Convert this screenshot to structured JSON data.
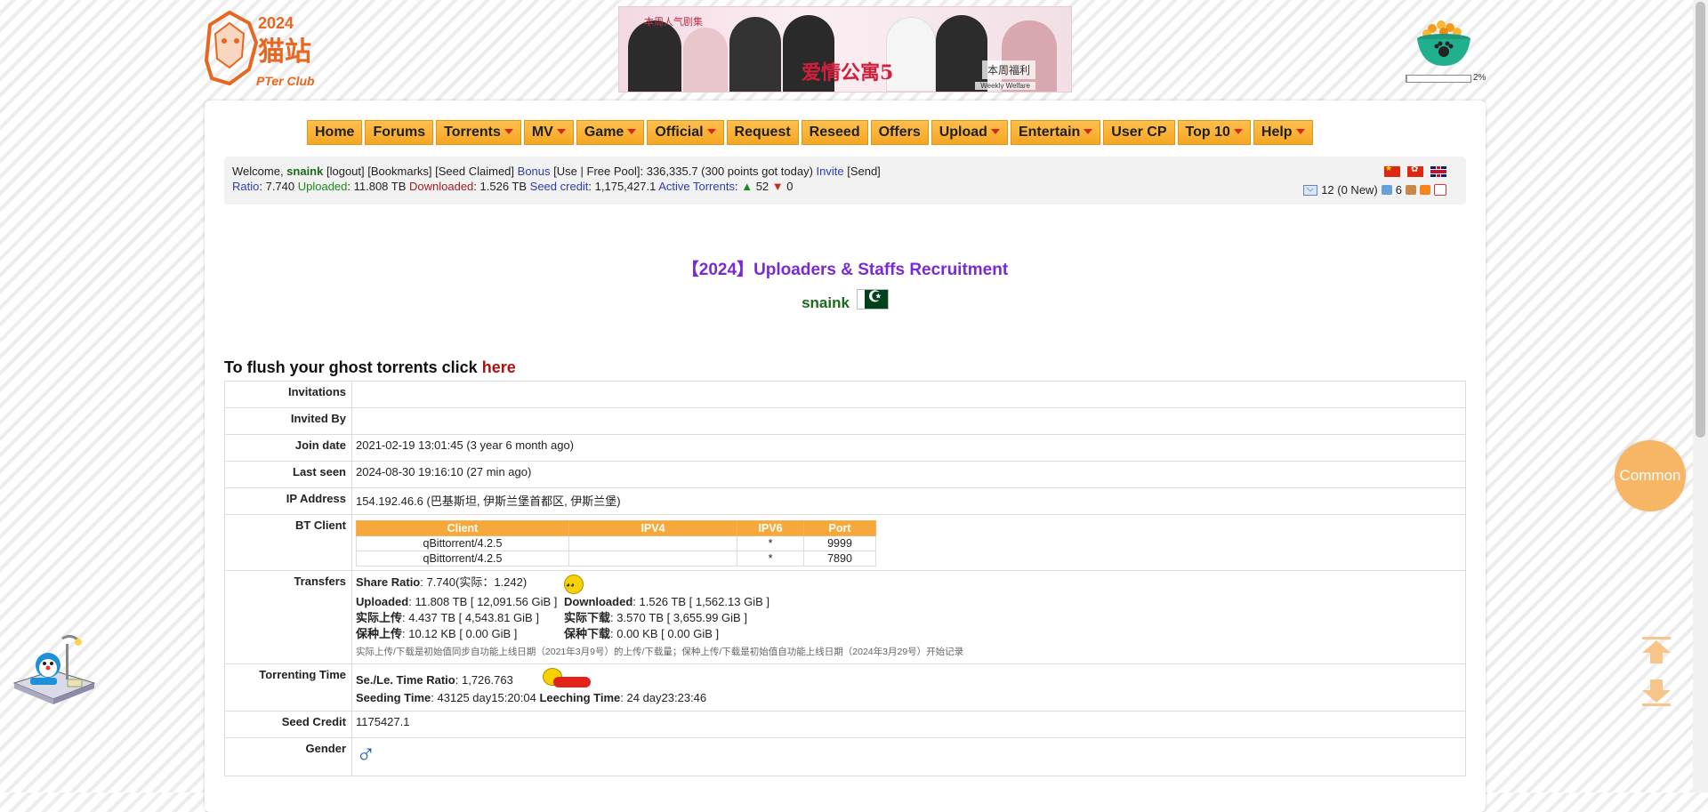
{
  "logo": {
    "text_main": "猫站",
    "text_sub": "PTer Club",
    "year": "2024"
  },
  "banner": {
    "title": "爱情公寓5",
    "top_text": "本周人气剧集",
    "side_text": "本周福利",
    "side_sub": "Weekly Welfare"
  },
  "progress": {
    "percent": 2,
    "label": "2%"
  },
  "nav": [
    {
      "label": "Home",
      "dropdown": false
    },
    {
      "label": "Forums",
      "dropdown": false
    },
    {
      "label": "Torrents",
      "dropdown": true
    },
    {
      "label": "MV",
      "dropdown": true
    },
    {
      "label": "Game",
      "dropdown": true
    },
    {
      "label": "Official",
      "dropdown": true
    },
    {
      "label": "Request",
      "dropdown": false
    },
    {
      "label": "Reseed",
      "dropdown": false
    },
    {
      "label": "Offers",
      "dropdown": false
    },
    {
      "label": "Upload",
      "dropdown": true
    },
    {
      "label": "Entertain",
      "dropdown": true
    },
    {
      "label": "User CP",
      "dropdown": false
    },
    {
      "label": "Top 10",
      "dropdown": true
    },
    {
      "label": "Help",
      "dropdown": true
    }
  ],
  "userbar": {
    "welcome": "Welcome, ",
    "username": "snaink",
    "logout": "[logout]",
    "bookmarks": "[Bookmarks]",
    "seed_claimed": "[Seed Claimed]",
    "bonus_label": "Bonus",
    "bonus_use_open": " [",
    "bonus_use": "Use",
    "bonus_sep": " | ",
    "free_pool": "Free Pool",
    "bonus_value": "]: 336,335.7 (300 points got today) ",
    "invite": "Invite",
    "send": " [Send]",
    "ratio_label": "Ratio",
    "ratio_value": ": 7.740 ",
    "uploaded_label": "Uploaded",
    "uploaded_value": ": 11.808 TB ",
    "downloaded_label": "Downloaded",
    "downloaded_value": ": 1.526 TB ",
    "seed_credit_label": "Seed credit",
    "seed_credit_value": ": 1,175,427.1 ",
    "active_label": "Active Torrents",
    "active_sep": ": ",
    "seeding_count": "52",
    "leeching_count": "0",
    "messages": "12 (0 New)",
    "friends": "6"
  },
  "recruitment": "【2024】Uploaders & Staffs Recruitment",
  "profile_name": "snaink",
  "flush": {
    "text": "To flush your ghost torrents click ",
    "link": "here"
  },
  "info": {
    "invitations": {
      "label": "Invitations",
      "value": ""
    },
    "invited_by": {
      "label": "Invited By",
      "value": ""
    },
    "join_date": {
      "label": "Join date",
      "value": "2021-02-19 13:01:45 (3 year 6 month ago)"
    },
    "last_seen": {
      "label": "Last seen",
      "value": "2024-08-30 19:16:10 (27 min ago)"
    },
    "ip": {
      "label": "IP Address",
      "value": "154.192.46.6 (巴基斯坦, 伊斯兰堡首都区, 伊斯兰堡)"
    },
    "bt_client_label": "BT Client",
    "transfers_label": "Transfers",
    "torrenting_label": "Torrenting Time",
    "seed_credit": {
      "label": "Seed Credit",
      "value": "1175427.1"
    },
    "gender": {
      "label": "Gender",
      "symbol": "♂"
    }
  },
  "bt_table": {
    "headers": [
      "Client",
      "IPV4",
      "IPV6",
      "Port"
    ],
    "rows": [
      [
        "qBittorrent/4.2.5",
        "",
        "*",
        "9999"
      ],
      [
        "qBittorrent/4.2.5",
        "",
        "*",
        "7890"
      ]
    ]
  },
  "transfers": {
    "share_ratio_label": "Share Ratio",
    "share_ratio_value": ": 7.740(实际：1.242)",
    "uploaded_label": "Uploaded",
    "uploaded_value": ": 11.808 TB [ 12,091.56 GiB ]",
    "downloaded_label": "Downloaded",
    "downloaded_value": ": 1.526 TB [ 1,562.13 GiB ]",
    "real_up_label": "实际上传",
    "real_up_value": ": 4.437 TB [ 4,543.81 GiB ]",
    "real_down_label": "实际下载",
    "real_down_value": ": 3.570 TB [ 3,655.99 GiB ]",
    "keep_up_label": "保种上传",
    "keep_up_value": ": 10.12 KB [ 0.00 GiB ]",
    "keep_down_label": "保种下载",
    "keep_down_value": ": 0.00 KB [ 0.00 GiB ]",
    "note": "实际上传/下载是初始值同步自功能上线日期（2021年3月9号）的上传/下载量；保种上传/下载是初始值自功能上线日期（2024年3月29号）开始记录"
  },
  "torrenting": {
    "ratio_label": "Se./Le. Time Ratio",
    "ratio_value": ": 1,726.763",
    "seeding_label": "Seeding Time",
    "seeding_value": ": 43125 day15:20:04",
    "leeching_label": "Leeching Time",
    "leeching_value": ": 24 day23:23:46"
  },
  "common_button": "Common"
}
